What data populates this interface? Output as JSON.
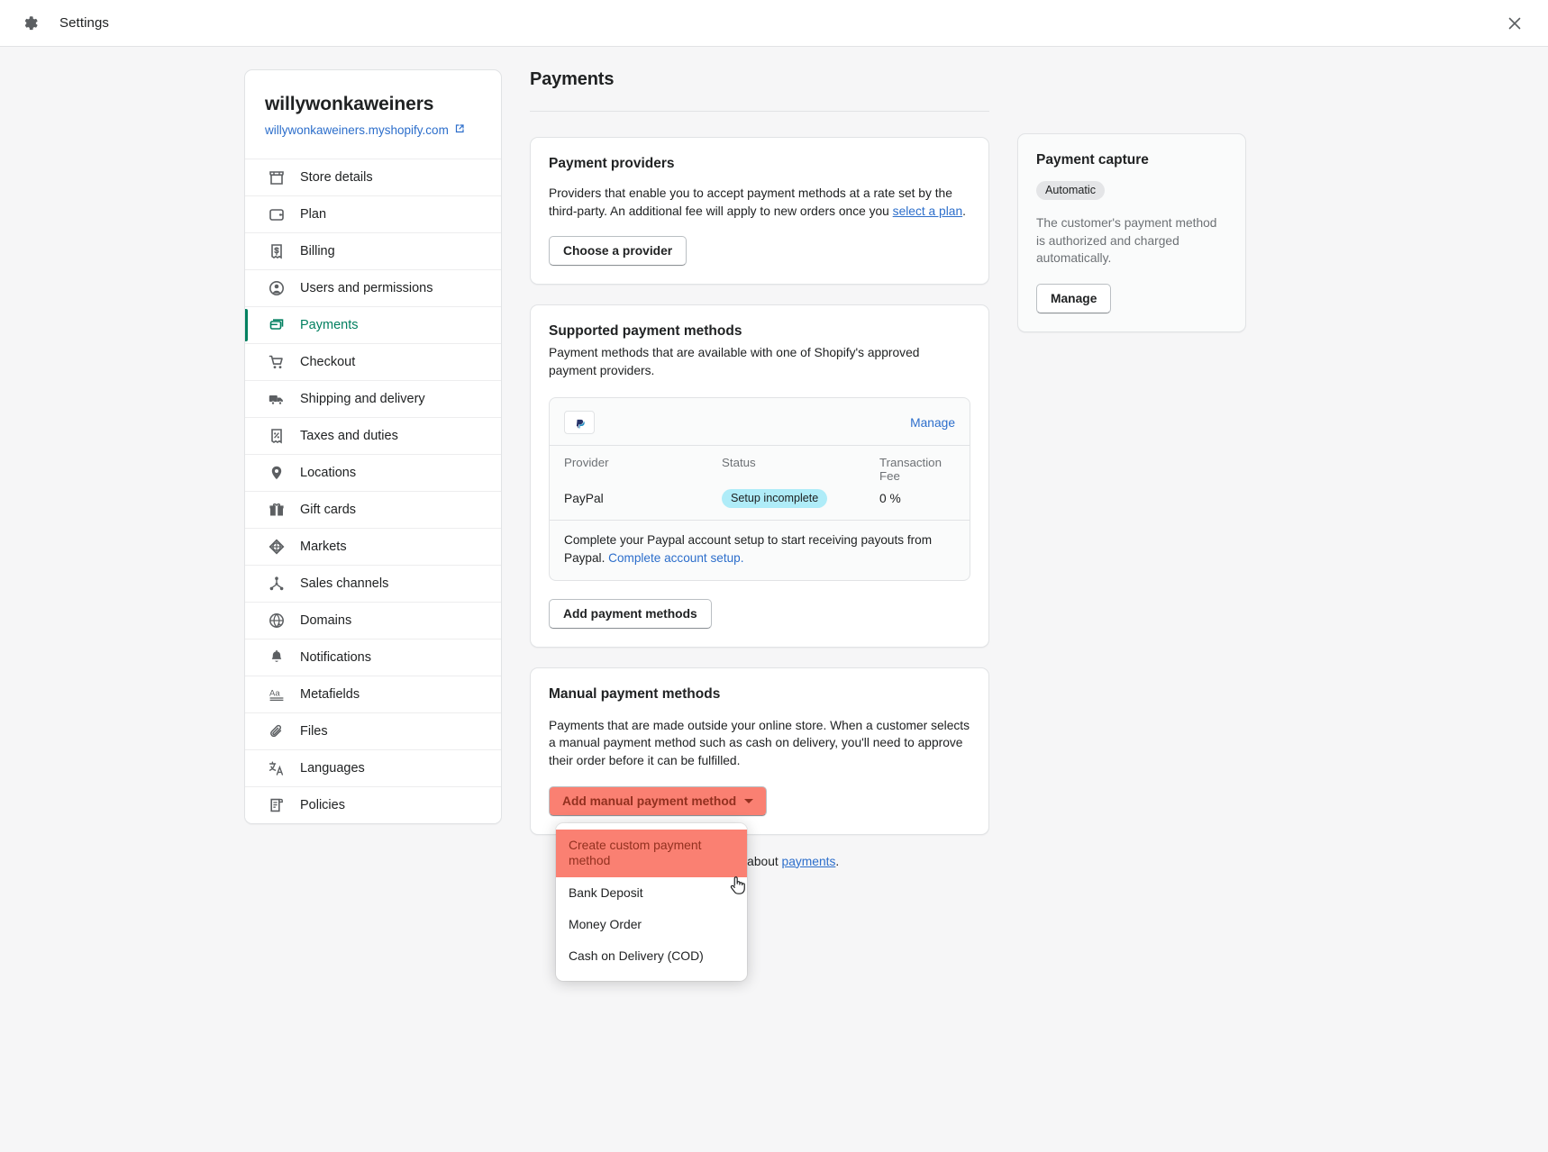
{
  "window": {
    "title": "Settings",
    "gear_icon": "gear-icon",
    "close_icon": "close-icon"
  },
  "sidebar": {
    "store_name": "willywonkaweiners",
    "store_url": "willywonkaweiners.myshopify.com",
    "external_link_icon": "external-link-icon",
    "items": [
      {
        "label": "Store details",
        "icon": "store-icon",
        "active": false
      },
      {
        "label": "Plan",
        "icon": "wallet-icon",
        "active": false
      },
      {
        "label": "Billing",
        "icon": "receipt-dollar-icon",
        "active": false
      },
      {
        "label": "Users and permissions",
        "icon": "user-icon",
        "active": false
      },
      {
        "label": "Payments",
        "icon": "payment-card-icon",
        "active": true
      },
      {
        "label": "Checkout",
        "icon": "shopping-cart-icon",
        "active": false
      },
      {
        "label": "Shipping and delivery",
        "icon": "truck-icon",
        "active": false
      },
      {
        "label": "Taxes and duties",
        "icon": "percent-receipt-icon",
        "active": false
      },
      {
        "label": "Locations",
        "icon": "map-pin-icon",
        "active": false
      },
      {
        "label": "Gift cards",
        "icon": "gift-icon",
        "active": false
      },
      {
        "label": "Markets",
        "icon": "globe-target-icon",
        "active": false
      },
      {
        "label": "Sales channels",
        "icon": "network-nodes-icon",
        "active": false
      },
      {
        "label": "Domains",
        "icon": "globe-icon",
        "active": false
      },
      {
        "label": "Notifications",
        "icon": "bell-icon",
        "active": false
      },
      {
        "label": "Metafields",
        "icon": "text-aa-icon",
        "active": false
      },
      {
        "label": "Files",
        "icon": "paperclip-icon",
        "active": false
      },
      {
        "label": "Languages",
        "icon": "translate-icon",
        "active": false
      },
      {
        "label": "Policies",
        "icon": "scroll-document-icon",
        "active": false
      }
    ]
  },
  "main": {
    "page_title": "Payments",
    "providers": {
      "heading": "Payment providers",
      "description_part1": "Providers that enable you to accept payment methods at a rate set by the third-party. An additional fee will apply to new orders once you ",
      "description_link": "select a plan",
      "description_part2": ".",
      "button": "Choose a provider"
    },
    "supported": {
      "heading": "Supported payment methods",
      "description": "Payment methods that are available with one of Shopify's approved payment providers.",
      "manage_link": "Manage",
      "provider_logo": "paypal-logo-icon",
      "columns": {
        "provider": "Provider",
        "status": "Status",
        "fee": "Transaction Fee"
      },
      "row": {
        "provider": "PayPal",
        "status": "Setup incomplete",
        "fee": "0 %"
      },
      "footer_text": "Complete your Paypal account setup to start receiving payouts from Paypal. ",
      "footer_link": "Complete account setup",
      "footer_end": ".",
      "add_button": "Add payment methods"
    },
    "manual": {
      "heading": "Manual payment methods",
      "description": "Payments that are made outside your online store. When a customer selects a manual payment method such as cash on delivery, you'll need to approve their order before it can be fulfilled.",
      "button": "Add manual payment method",
      "caret_icon": "chevron-down-icon",
      "menu": [
        {
          "label": "Create custom payment method",
          "highlighted": true
        },
        {
          "label": "Bank Deposit",
          "highlighted": false
        },
        {
          "label": "Money Order",
          "highlighted": false
        },
        {
          "label": "Cash on Delivery (COD)",
          "highlighted": false
        }
      ],
      "cursor_icon": "pointing-hand-cursor-icon"
    },
    "footer": {
      "text_before": "Learn more about ",
      "link": "payments",
      "text_after": "."
    }
  },
  "right": {
    "capture": {
      "heading": "Payment capture",
      "badge": "Automatic",
      "description": "The customer's payment method is authorized and charged automatically.",
      "button": "Manage"
    }
  },
  "colors": {
    "accent_green": "#008060",
    "link_blue": "#2c6ecb",
    "highlight_salmon": "#fa8072",
    "badge_teal": "#afecf8",
    "page_bg": "#f6f6f7"
  }
}
